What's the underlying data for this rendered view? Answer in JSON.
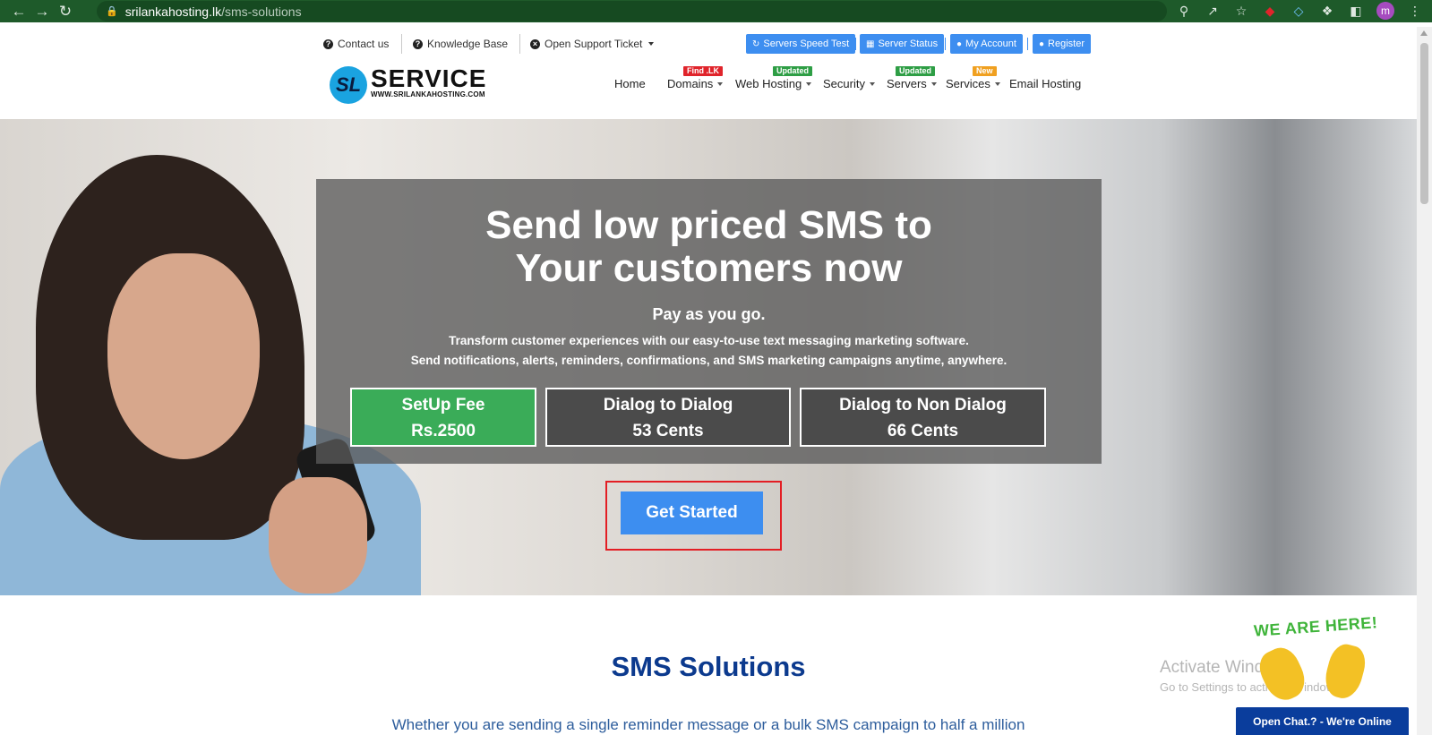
{
  "browser": {
    "url_domain": "srilankahosting.lk",
    "url_path": "/sms-solutions",
    "profile_initial": "m"
  },
  "topbar": {
    "contact": "Contact us",
    "knowledge": "Knowledge Base",
    "ticket": "Open Support Ticket",
    "speed_test": "Servers Speed Test",
    "server_status": "Server Status",
    "my_account": "My Account",
    "register": "Register"
  },
  "logo": {
    "initials": "SL",
    "brand": "SERVICE",
    "tagline": "WWW.SRILANKAHOSTING.COM"
  },
  "nav": {
    "home": "Home",
    "domains": "Domains",
    "domains_badge": "Find .LK",
    "web_hosting": "Web Hosting",
    "web_hosting_badge": "Updated",
    "security": "Security",
    "servers": "Servers",
    "servers_badge": "Updated",
    "services": "Services",
    "services_badge": "New",
    "email_hosting": "Email Hosting",
    "badge_colors": {
      "red": "#e0242b",
      "green": "#2e9e45",
      "orange": "#f0a020"
    }
  },
  "hero": {
    "title_line1": "Send low priced SMS to",
    "title_line2": "Your customers now",
    "subtitle": "Pay as you go.",
    "desc_line1": "Transform customer experiences with our easy-to-use text messaging marketing software.",
    "desc_line2": "Send notifications, alerts, reminders, confirmations, and SMS marketing campaigns anytime, anywhere.",
    "setup_label": "SetUp Fee",
    "setup_value": "Rs.2500",
    "dialog_label": "Dialog to Dialog",
    "dialog_value": "53 Cents",
    "nondialog_label": "Dialog to Non Dialog",
    "nondialog_value": "66 Cents",
    "cta": "Get Started"
  },
  "section": {
    "title": "SMS Solutions",
    "text": "Whether you are sending a single reminder message or a bulk SMS campaign to half a million"
  },
  "watermark": {
    "line1": "Activate Windows",
    "line2": "Go to Settings to activate Windows."
  },
  "chat": {
    "wave_text": "WE ARE HERE!",
    "bar_text": "Open Chat.? - We're Online"
  }
}
